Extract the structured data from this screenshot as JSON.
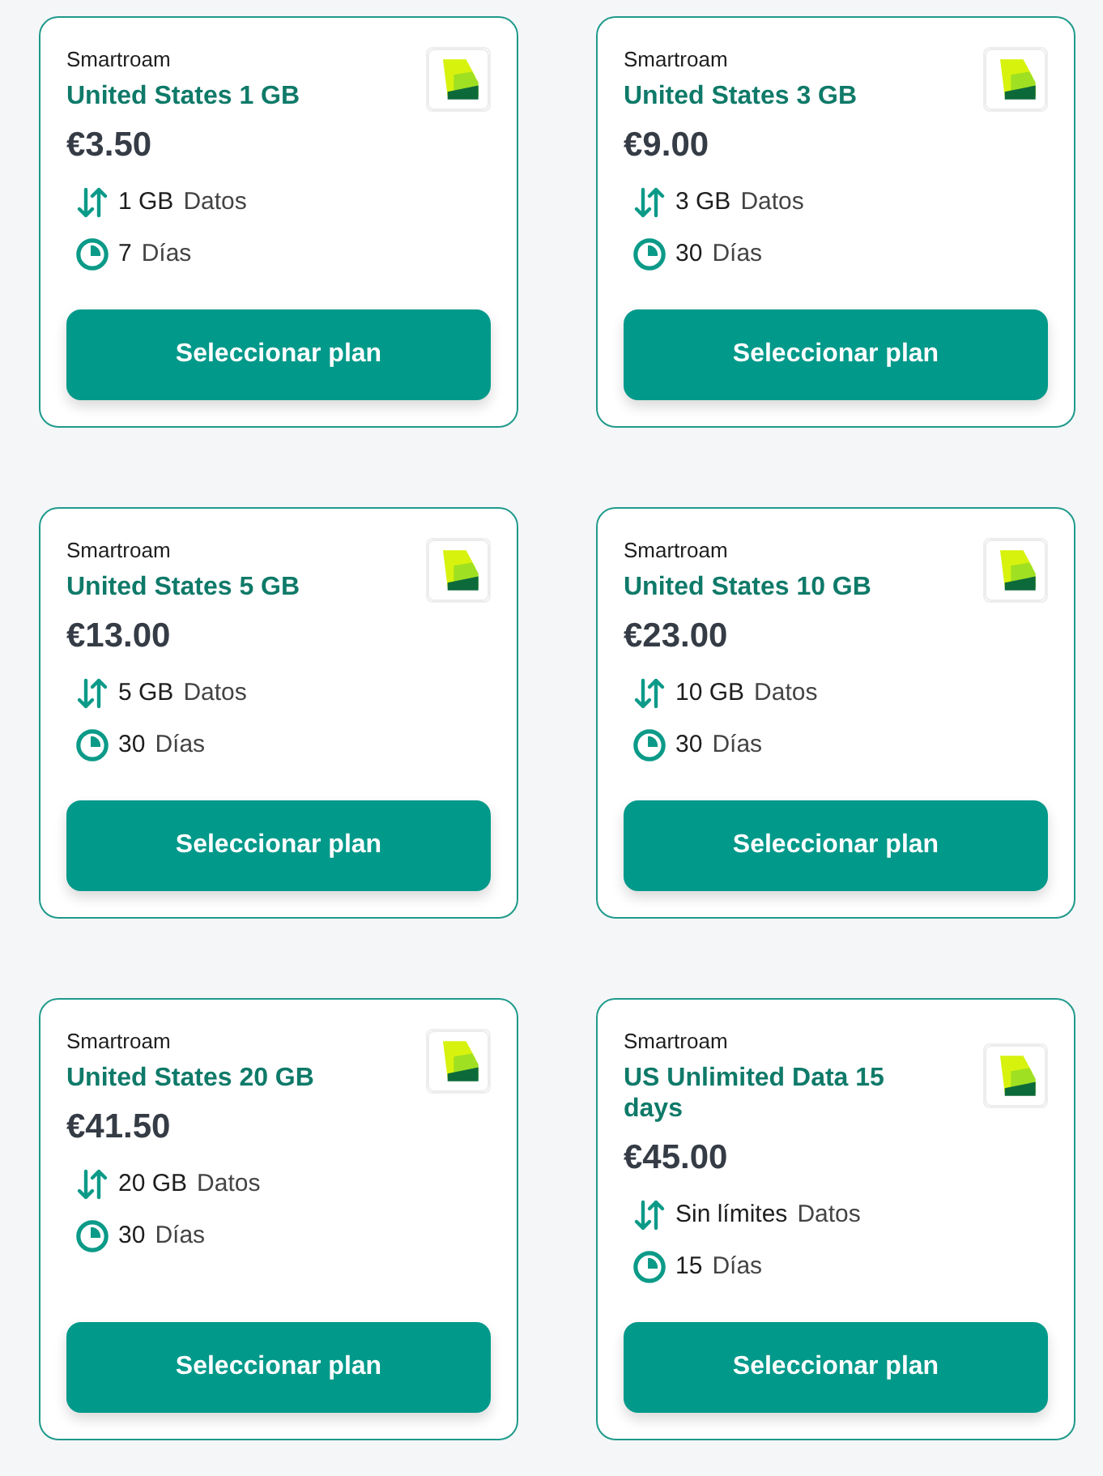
{
  "plans": [
    {
      "provider": "Smartroam",
      "title": "United States 1 GB",
      "price": "€3.50",
      "data": {
        "amount": "1 GB",
        "unit": "Datos"
      },
      "duration": {
        "amount": "7",
        "unit": "Días"
      },
      "button": "Seleccionar plan"
    },
    {
      "provider": "Smartroam",
      "title": "United States 3 GB",
      "price": "€9.00",
      "data": {
        "amount": "3 GB",
        "unit": "Datos"
      },
      "duration": {
        "amount": "30",
        "unit": "Días"
      },
      "button": "Seleccionar plan"
    },
    {
      "provider": "Smartroam",
      "title": "United States 5 GB",
      "price": "€13.00",
      "data": {
        "amount": "5 GB",
        "unit": "Datos"
      },
      "duration": {
        "amount": "30",
        "unit": "Días"
      },
      "button": "Seleccionar plan"
    },
    {
      "provider": "Smartroam",
      "title": "United States 10 GB",
      "price": "€23.00",
      "data": {
        "amount": "10 GB",
        "unit": "Datos"
      },
      "duration": {
        "amount": "30",
        "unit": "Días"
      },
      "button": "Seleccionar plan"
    },
    {
      "provider": "Smartroam",
      "title": "United States 20 GB",
      "price": "€41.50",
      "data": {
        "amount": "20 GB",
        "unit": "Datos"
      },
      "duration": {
        "amount": "30",
        "unit": "Días"
      },
      "button": "Seleccionar plan"
    },
    {
      "provider": "Smartroam",
      "title": "US Unlimited Data 15 days",
      "price": "€45.00",
      "data": {
        "amount": "Sin límites",
        "unit": "Datos"
      },
      "duration": {
        "amount": "15",
        "unit": "Días"
      },
      "button": "Seleccionar plan"
    }
  ]
}
